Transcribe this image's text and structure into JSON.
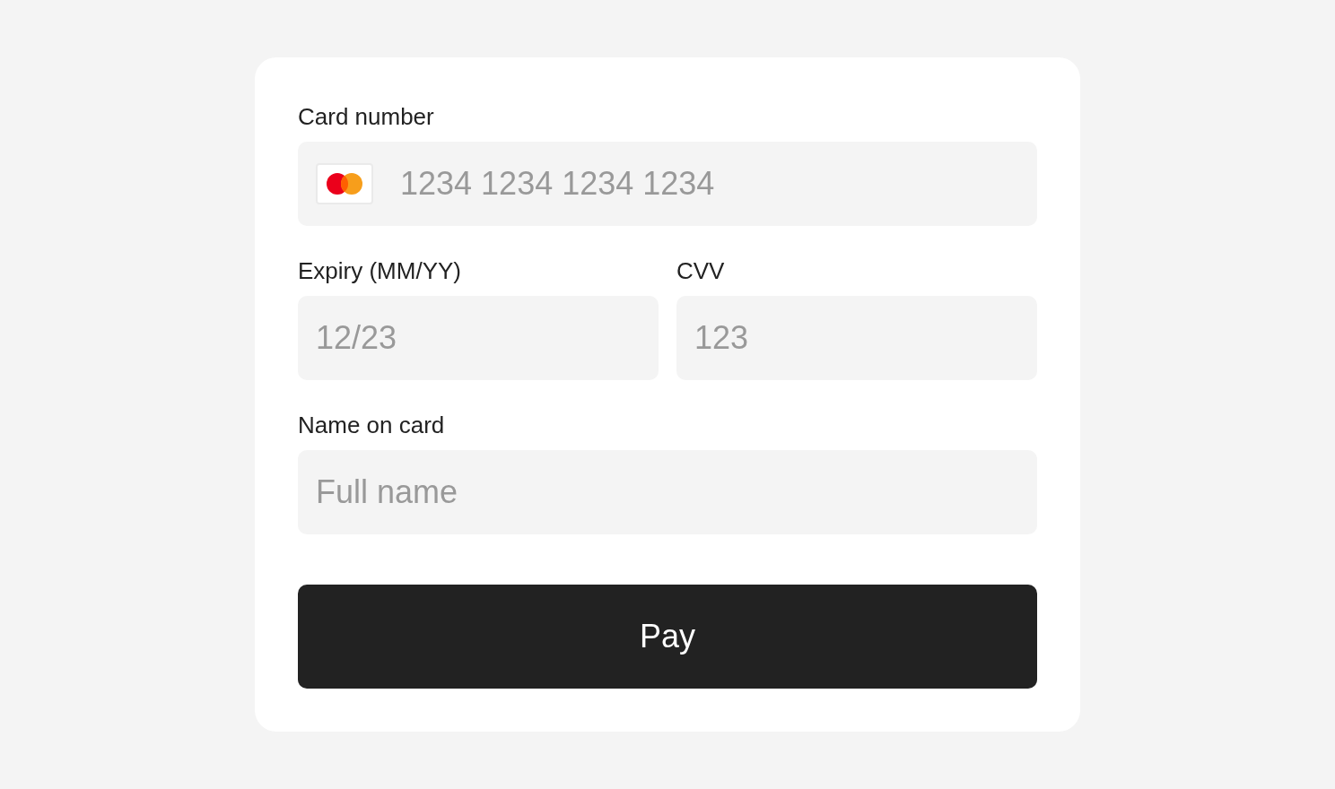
{
  "form": {
    "fields": [
      {
        "label": "Card number",
        "placeholder": "1234 1234 1234 1234",
        "kind": "card"
      },
      {
        "label": "Expiry (MM/YY)",
        "placeholder": "12/23",
        "kind": "half"
      },
      {
        "label": "CVV",
        "placeholder": "123",
        "kind": "half"
      },
      {
        "label": "Name on card",
        "placeholder": "Full name",
        "kind": "full"
      }
    ],
    "submit_button": "Pay"
  }
}
